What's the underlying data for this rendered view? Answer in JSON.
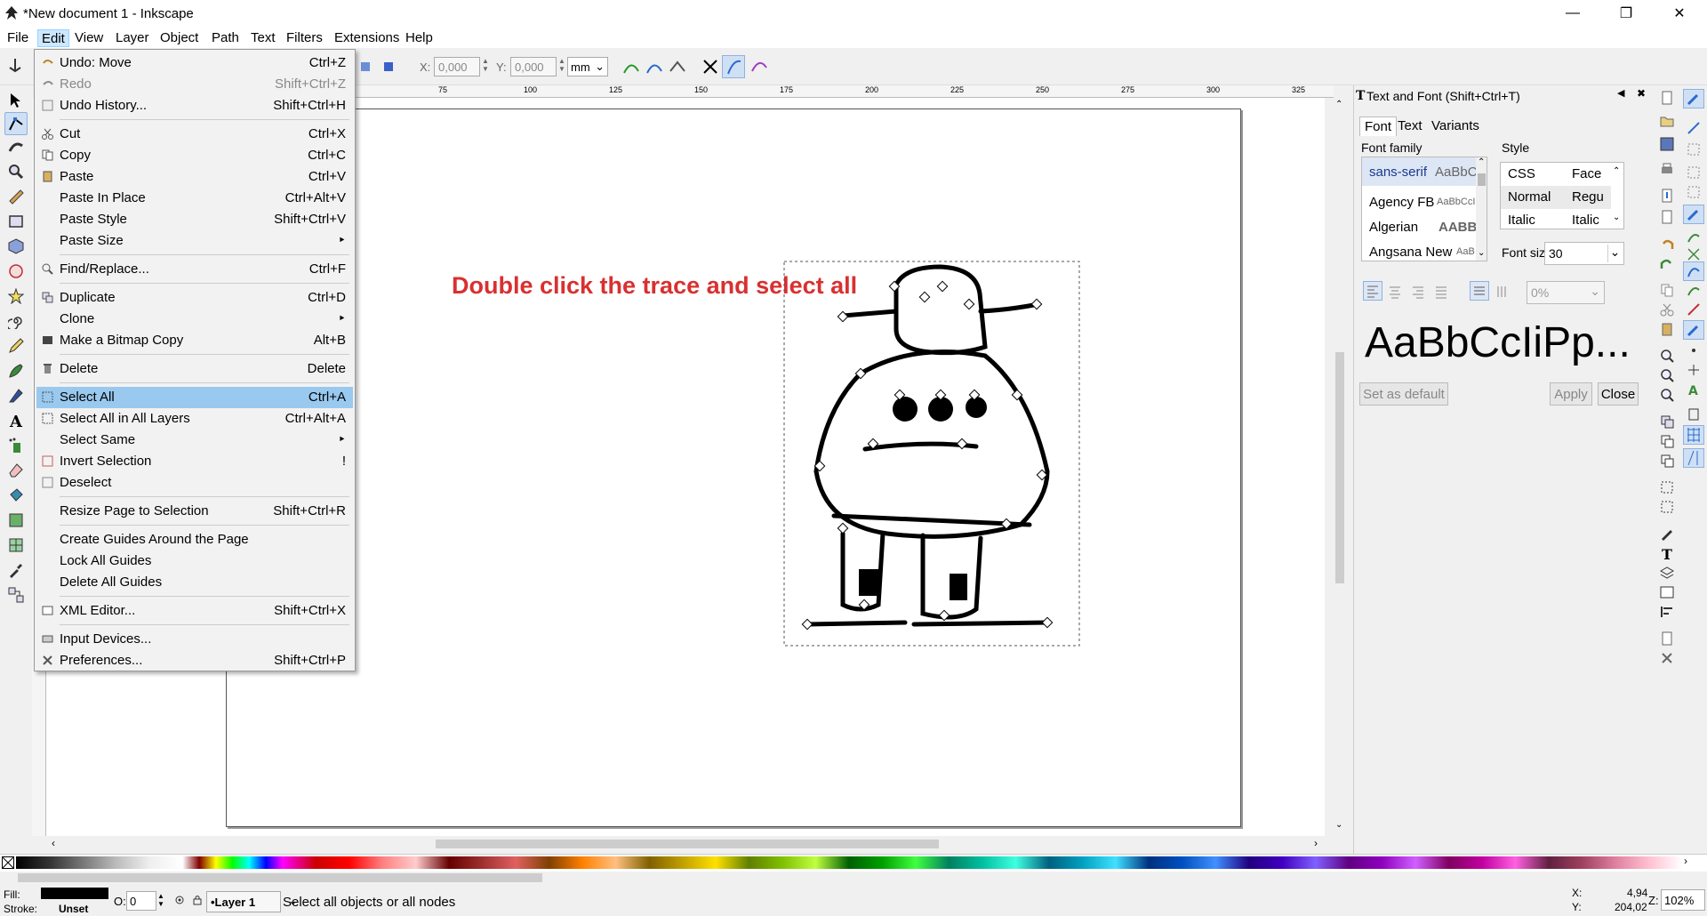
{
  "window": {
    "title": "*New document 1 - Inkscape"
  },
  "menubar": {
    "items": [
      "File",
      "Edit",
      "View",
      "Layer",
      "Object",
      "Path",
      "Text",
      "Filters",
      "Extensions",
      "Help"
    ],
    "active": "Edit"
  },
  "toolbar": {
    "x_label": "X:",
    "x_value": "0,000",
    "y_label": "Y:",
    "y_value": "0,000",
    "unit": "mm"
  },
  "ruler": {
    "ticks": [
      "75",
      "100",
      "125",
      "150",
      "175",
      "200",
      "225",
      "250",
      "275",
      "300",
      "325"
    ]
  },
  "canvas": {
    "annotation": "Double click the trace and select all"
  },
  "edit_menu": {
    "items": [
      {
        "label": "Undo: Move",
        "shortcut": "Ctrl+Z"
      },
      {
        "label": "Redo",
        "shortcut": "Shift+Ctrl+Z"
      },
      {
        "label": "Undo History...",
        "shortcut": "Shift+Ctrl+H"
      },
      {
        "label": "Cut",
        "shortcut": "Ctrl+X"
      },
      {
        "label": "Copy",
        "shortcut": "Ctrl+C"
      },
      {
        "label": "Paste",
        "shortcut": "Ctrl+V"
      },
      {
        "label": "Paste In Place",
        "shortcut": "Ctrl+Alt+V"
      },
      {
        "label": "Paste Style",
        "shortcut": "Shift+Ctrl+V"
      },
      {
        "label": "Paste Size",
        "shortcut": ""
      },
      {
        "label": "Find/Replace...",
        "shortcut": "Ctrl+F"
      },
      {
        "label": "Duplicate",
        "shortcut": "Ctrl+D"
      },
      {
        "label": "Clone",
        "shortcut": ""
      },
      {
        "label": "Make a Bitmap Copy",
        "shortcut": "Alt+B"
      },
      {
        "label": "Delete",
        "shortcut": "Delete"
      },
      {
        "label": "Select All",
        "shortcut": "Ctrl+A"
      },
      {
        "label": "Select All in All Layers",
        "shortcut": "Ctrl+Alt+A"
      },
      {
        "label": "Select Same",
        "shortcut": ""
      },
      {
        "label": "Invert Selection",
        "shortcut": "!"
      },
      {
        "label": "Deselect",
        "shortcut": ""
      },
      {
        "label": "Resize Page to Selection",
        "shortcut": "Shift+Ctrl+R"
      },
      {
        "label": "Create Guides Around the Page",
        "shortcut": ""
      },
      {
        "label": "Lock All Guides",
        "shortcut": ""
      },
      {
        "label": "Delete All Guides",
        "shortcut": ""
      },
      {
        "label": "XML Editor...",
        "shortcut": "Shift+Ctrl+X"
      },
      {
        "label": "Input Devices...",
        "shortcut": ""
      },
      {
        "label": "Preferences...",
        "shortcut": "Shift+Ctrl+P"
      }
    ]
  },
  "text_font_dialog": {
    "title": "Text and Font (Shift+Ctrl+T)",
    "tabs": [
      "Font",
      "Text",
      "Variants"
    ],
    "font_family_label": "Font family",
    "style_label": "Style",
    "fonts": [
      {
        "name": "sans-serif",
        "preview": "AaBbCc"
      },
      {
        "name": "Agency FB",
        "preview": "AaBbCcIi"
      },
      {
        "name": "Algerian",
        "preview": "AABBC"
      },
      {
        "name": "Angsana New",
        "preview": "AaB"
      }
    ],
    "style_header": [
      "CSS",
      "Face"
    ],
    "styles": [
      {
        "css": "Normal",
        "face": "Regu"
      },
      {
        "css": "Italic",
        "face": "Italic"
      }
    ],
    "font_size_label": "Font siz",
    "font_size_value": "30",
    "spacing_value": "0%",
    "preview_text": "AaBbCcIiPp...",
    "set_default": "Set as default",
    "apply": "Apply",
    "close": "Close"
  },
  "statusbar": {
    "fill_label": "Fill:",
    "stroke_label": "Stroke:",
    "stroke_value": "Unset",
    "opacity_label": "O:",
    "opacity_value": "0",
    "layer": "•Layer 1",
    "message": "Select all objects or all nodes",
    "x_label": "X:",
    "x": "4,94",
    "y_label": "Y:",
    "y": "204,02",
    "zoom_label": "Z:",
    "zoom": "102%"
  },
  "colors": {
    "accent": "#99c9ef",
    "annotation": "#d93030"
  }
}
